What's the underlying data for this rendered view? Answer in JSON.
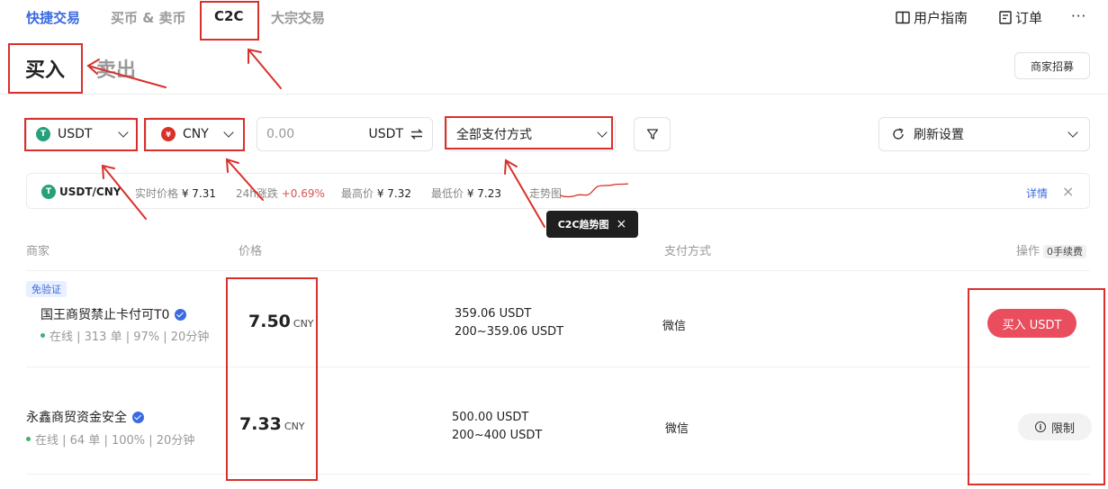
{
  "nav": {
    "tabs": [
      "快捷交易",
      "买币 & 卖币",
      "C2C",
      "大宗交易"
    ],
    "guide": "用户指南",
    "orders": "订单",
    "more": "···"
  },
  "trade_tabs": {
    "buy": "买入",
    "sell": "卖出"
  },
  "merchant_recruit": "商家招募",
  "filters": {
    "crypto": "USDT",
    "fiat": "CNY",
    "amount_placeholder": "0.00",
    "amount_unit": "USDT",
    "payment": "全部支付方式",
    "refresh": "刷新设置"
  },
  "ticker": {
    "pair": "USDT/CNY",
    "price_label": "实时价格",
    "price": "¥ 7.31",
    "change_label": "24h涨跌",
    "change": "+0.69%",
    "high_label": "最高价",
    "high": "¥ 7.32",
    "low_label": "最低价",
    "low": "¥ 7.23",
    "trend_label": "走势图",
    "details": "详情",
    "close": "×"
  },
  "tooltip": {
    "text": "C2C趋势图",
    "close": "×"
  },
  "table": {
    "headers": {
      "merchant": "商家",
      "price": "价格",
      "payment": "支付方式",
      "action": "操作",
      "fee": "0手续费"
    },
    "rows": [
      {
        "tag": "免验证",
        "name": "国王商贸禁止卡付可T0",
        "stats": "在线 | 313 单 | 97% | 20分钟",
        "price": "7.50",
        "currency": "CNY",
        "available": "359.06 USDT",
        "limit": "200~359.06 USDT",
        "payment": "微信",
        "action": "买入 USDT"
      },
      {
        "name": "永鑫商贸资金安全",
        "stats": "在线 | 64 单 | 100% | 20分钟",
        "price": "7.33",
        "currency": "CNY",
        "available": "500.00 USDT",
        "limit": "200~400 USDT",
        "payment": "微信",
        "action": "限制"
      }
    ]
  },
  "colors": {
    "accent": "#3b6ae0",
    "buy": "#e94d5e",
    "annotation": "#d9302b",
    "tether": "#26a17b"
  }
}
